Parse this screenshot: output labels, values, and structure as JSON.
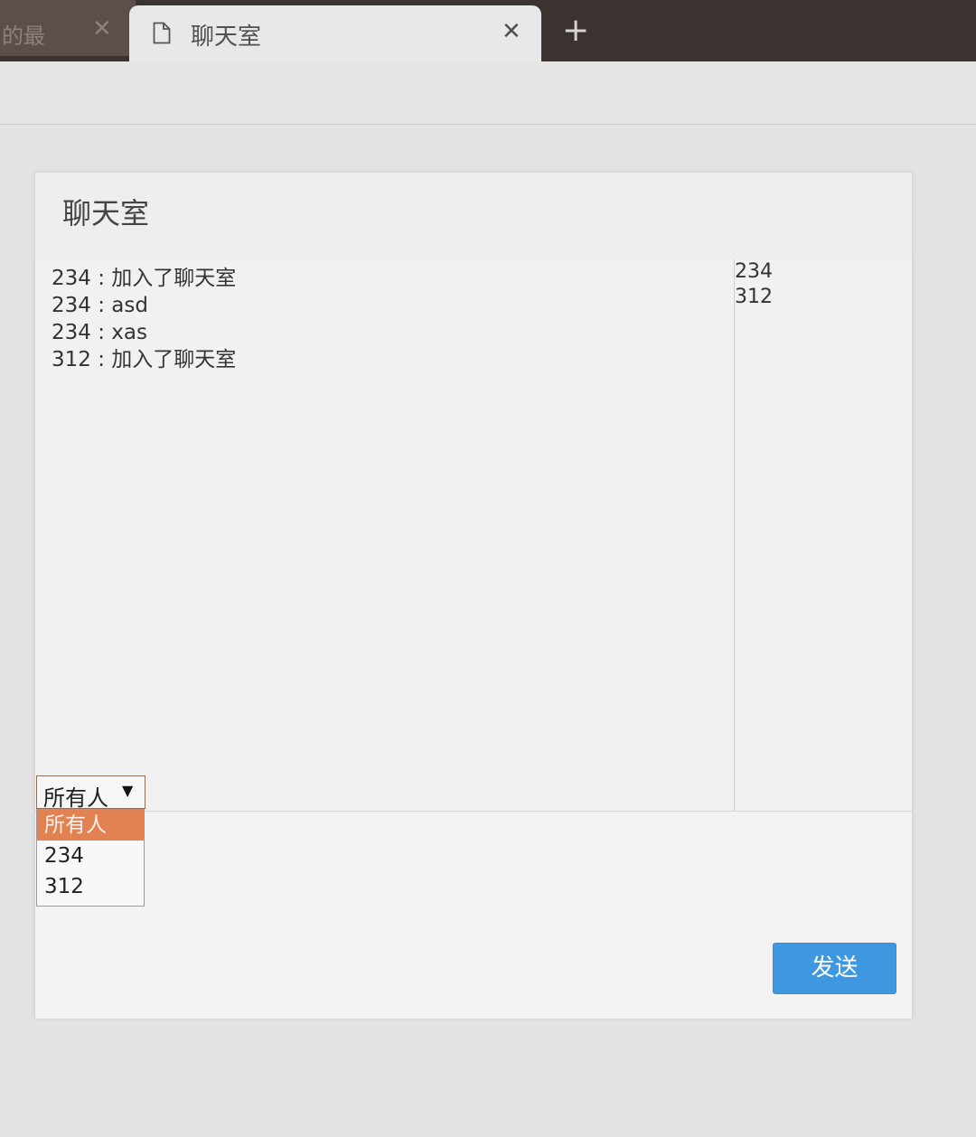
{
  "browser": {
    "tabs": [
      {
        "title": "的最",
        "active": false,
        "close": "✕"
      },
      {
        "title": "聊天室",
        "active": true,
        "close": "✕"
      }
    ],
    "new_tab": "+"
  },
  "chat": {
    "title": "聊天室",
    "messages": [
      {
        "text": "234 : 加入了聊天室"
      },
      {
        "text": "234 : asd"
      },
      {
        "text": "234 : xas"
      },
      {
        "text": "312 : 加入了聊天室"
      }
    ],
    "users": [
      "234",
      "312"
    ],
    "recipient_select": {
      "value": "所有人",
      "options": [
        "所有人",
        "234",
        "312"
      ],
      "highlighted_index": 0
    },
    "send_label": "发送"
  },
  "colors": {
    "accent": "#3f97e0",
    "option_highlight": "#e28152"
  }
}
